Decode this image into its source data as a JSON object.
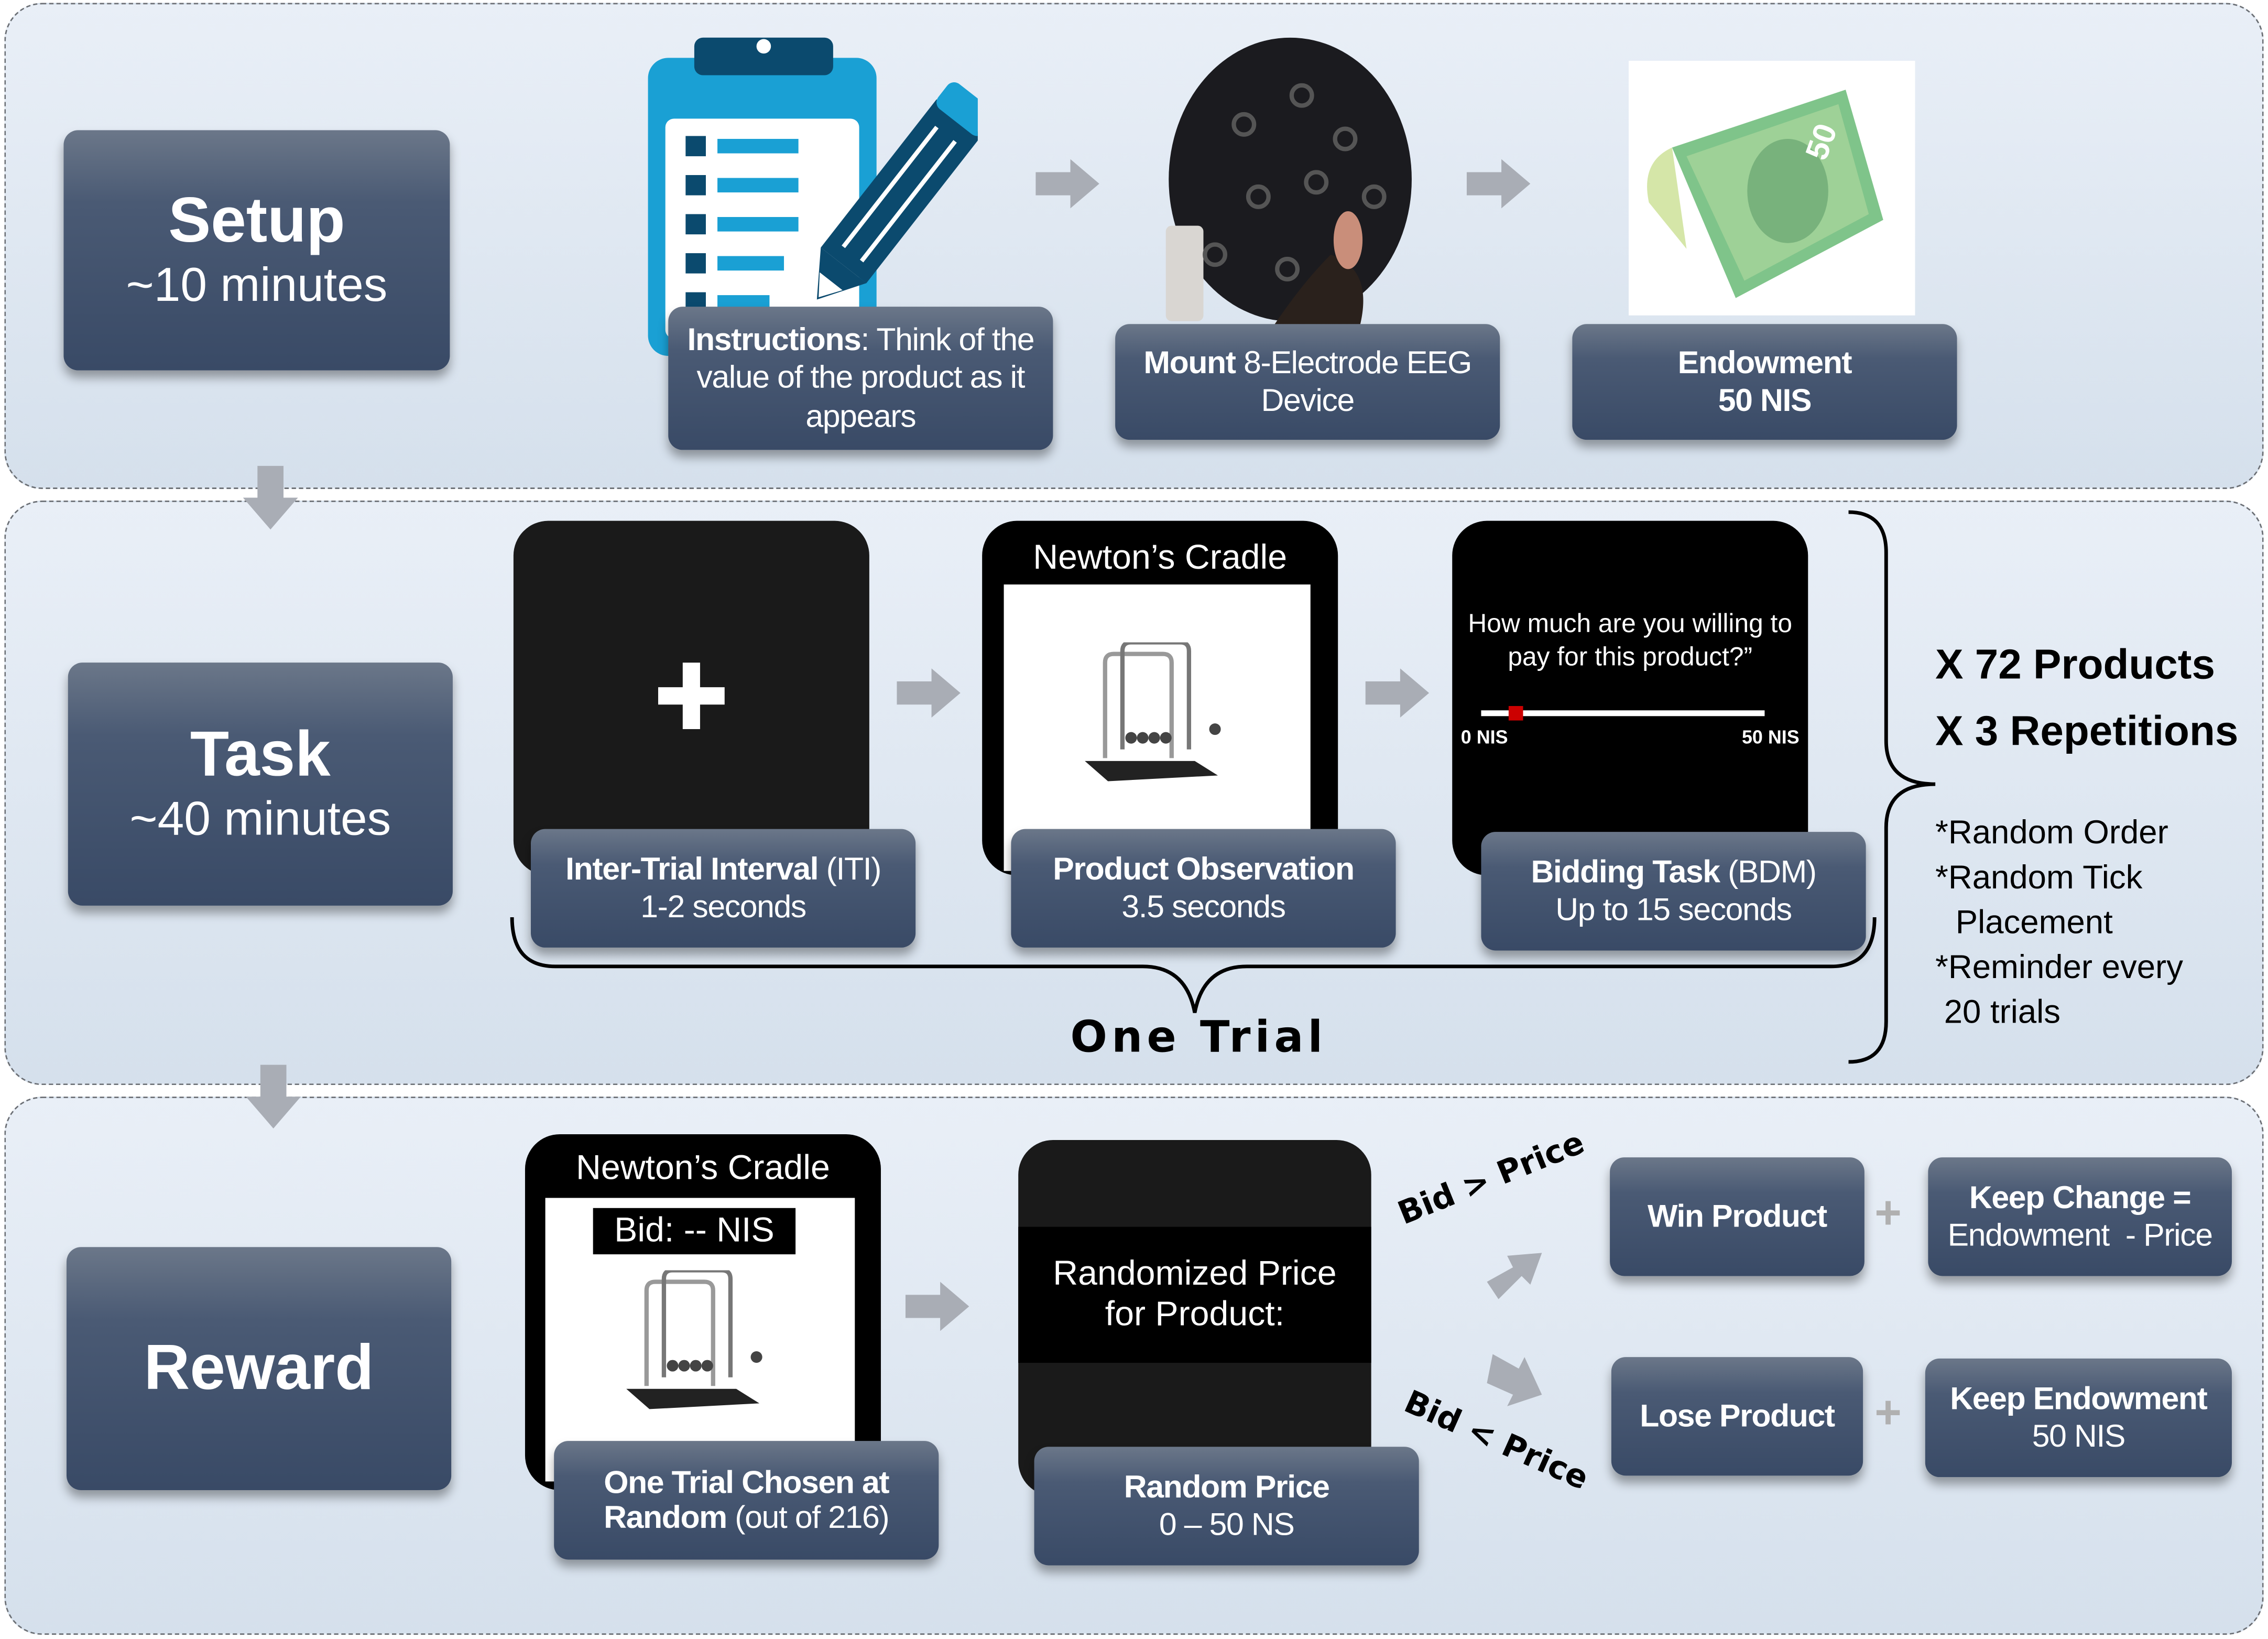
{
  "phases": {
    "setup": {
      "title": "Setup",
      "duration": "~10 minutes"
    },
    "task": {
      "title": "Task",
      "duration": "~40 minutes"
    },
    "reward": {
      "title": "Reward"
    }
  },
  "setup_steps": {
    "instructions": {
      "bold": "Instructions",
      "rest": ": Think of the value of the product as it appears"
    },
    "mount": {
      "bold": "Mount",
      "rest": " 8-Electrode EEG Device"
    },
    "endowment": {
      "title": "Endowment",
      "amount": "50 NIS"
    },
    "banknote_value": "50"
  },
  "task_steps": {
    "iti": {
      "bold": "Inter-Trial Interval",
      "rest": " (ITI)",
      "duration": "1-2 seconds"
    },
    "observation": {
      "screen_title": "Newton’s Cradle",
      "bold": "Product Observation",
      "duration": "3.5 seconds"
    },
    "bidding": {
      "question": "How much  are you willing to pay for this product?”",
      "scale_min": "0 NIS",
      "scale_max": "50 NIS",
      "tick_fraction": 0.06,
      "bold": "Bidding Task",
      "rest": " (BDM)",
      "duration": "Up to 15 seconds"
    },
    "one_trial_label": "One Trial",
    "products": "X 72 Products",
    "repetitions": "X 3 Repetitions",
    "notes": [
      "*Random Order",
      "*Random Tick",
      "Placement",
      "*Reminder every",
      "20 trials"
    ]
  },
  "reward_steps": {
    "chosen": {
      "screen_title": "Newton’s Cradle",
      "bid_label": "Bid: -- NIS",
      "bold": "One Trial Chosen at Random",
      "rest": " (out of 216)"
    },
    "price": {
      "screen_text_1": "Randomized Price",
      "screen_text_2": "for Product:",
      "title": "Random Price",
      "range": "0 – 50 NS"
    },
    "bid_gt": "Bid > Price",
    "bid_lt": "Bid < Price",
    "win": "Win Product",
    "lose": "Lose Product",
    "keep_change_title": "Keep Change =",
    "keep_change_formula": "Endowment  - Price",
    "keep_endowment_title": "Keep Endowment",
    "keep_endowment_amount": "50 NIS",
    "plus": "+"
  },
  "colors": {
    "navy": "#3b4b67",
    "panel": "#dfe8f2",
    "tick": "#cc0000",
    "clipboard_light": "#1aa0d4",
    "clipboard_dark": "#0b4a6e"
  }
}
